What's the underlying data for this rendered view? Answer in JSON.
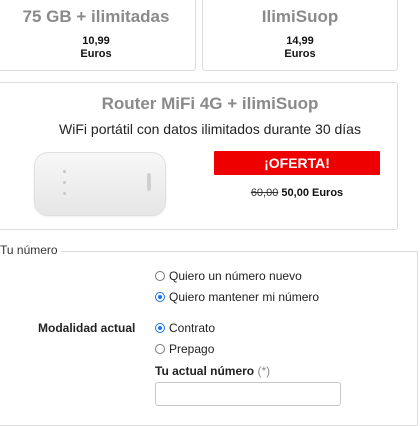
{
  "plans": [
    {
      "name": "75 GB + ilimitadas",
      "price": "10,99",
      "currency": "Euros"
    },
    {
      "name": "IlimiSuop",
      "price": "14,99",
      "currency": "Euros"
    }
  ],
  "router": {
    "title": "Router MiFi 4G + ilimiSuop",
    "subtitle": "WiFi portátil con datos ilimitados durante 30 días",
    "offer_label": "¡OFERTA!",
    "old_price": "60,00",
    "new_price": "50,00 Euros"
  },
  "number_section": {
    "legend": "Tu número",
    "options": [
      "Quiero un número nuevo",
      "Quiero mantener mi número"
    ],
    "selected_option": 1,
    "modality_label": "Modalidad actual",
    "modalities": [
      "Contrato",
      "Prepago"
    ],
    "selected_modality": 0,
    "number_label": "Tu actual número",
    "required_mark": "(*)",
    "number_value": ""
  },
  "colors": {
    "offer_red": "#ef0000",
    "radio_blue": "#1a73e8",
    "muted_title": "#8a8a8a"
  }
}
